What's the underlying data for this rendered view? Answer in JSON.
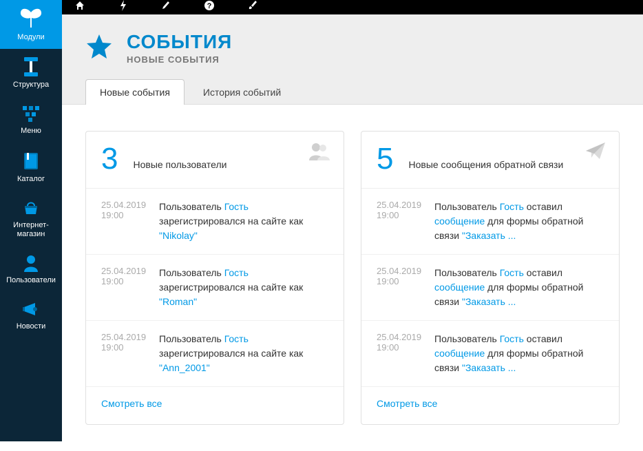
{
  "sidebar": {
    "items": [
      {
        "label": "Модули"
      },
      {
        "label": "Структура"
      },
      {
        "label": "Меню"
      },
      {
        "label": "Каталог"
      },
      {
        "label": "Интернет-\nмагазин"
      },
      {
        "label": "Пользователи"
      },
      {
        "label": "Новости"
      }
    ]
  },
  "page": {
    "title": "СОБЫТИЯ",
    "subtitle": "НОВЫЕ СОБЫТИЯ"
  },
  "tabs": [
    {
      "label": "Новые события"
    },
    {
      "label": "История событий"
    }
  ],
  "panels": [
    {
      "count": "3",
      "label": "Новые пользователи",
      "view_all": "Смотреть все",
      "rows": [
        {
          "date": "25.04.2019",
          "time": "19:00",
          "p1": "Пользователь ",
          "l1": "Гость",
          "p2": " зарегистрировался на сайте как ",
          "l2": "\"Nikolay\""
        },
        {
          "date": "25.04.2019",
          "time": "19:00",
          "p1": "Пользователь ",
          "l1": "Гость",
          "p2": " зарегистрировался на сайте как ",
          "l2": "\"Roman\""
        },
        {
          "date": "25.04.2019",
          "time": "19:00",
          "p1": "Пользователь ",
          "l1": "Гость",
          "p2": " зарегистрировался на сайте как ",
          "l2": "\"Ann_2001\""
        }
      ]
    },
    {
      "count": "5",
      "label": "Новые сообщения обратной связи",
      "view_all": "Смотреть все",
      "rows": [
        {
          "date": "25.04.2019",
          "time": "19:00",
          "p1": "Пользователь ",
          "l1": "Гость",
          "p2": " оставил ",
          "l2": "сообщение",
          "p3": " для формы обратной связи ",
          "l3": "\"Заказать ..."
        },
        {
          "date": "25.04.2019",
          "time": "19:00",
          "p1": "Пользователь ",
          "l1": "Гость",
          "p2": " оставил ",
          "l2": "сообщение",
          "p3": " для формы обратной связи ",
          "l3": "\"Заказать ..."
        },
        {
          "date": "25.04.2019",
          "time": "19:00",
          "p1": "Пользователь ",
          "l1": "Гость",
          "p2": " оставил ",
          "l2": "сообщение",
          "p3": " для формы обратной связи ",
          "l3": "\"Заказать ..."
        }
      ]
    }
  ]
}
